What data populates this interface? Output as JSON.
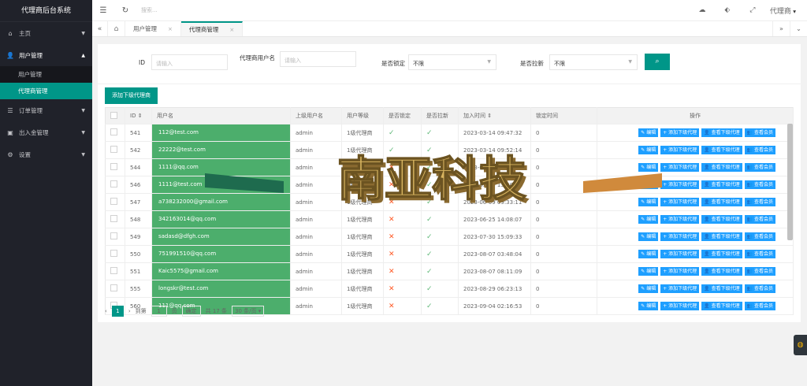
{
  "app_title": "代理商后台系统",
  "sidebar": {
    "items": [
      {
        "label": "主页"
      },
      {
        "label": "用户管理",
        "children": [
          "用户管理",
          "代理商管理"
        ]
      },
      {
        "label": "订单管理"
      },
      {
        "label": "出入金管理"
      },
      {
        "label": "设置"
      }
    ]
  },
  "topbar": {
    "search_placeholder": "搜索...",
    "user": "代理商"
  },
  "tabs": [
    {
      "label": "用户管理"
    },
    {
      "label": "代理商管理"
    }
  ],
  "filter": {
    "id_label": "ID",
    "id_placeholder": "请输入",
    "agent_label": "代理商用户名",
    "agent_placeholder": "请输入",
    "locked_label": "是否锁定",
    "locked_value": "不限",
    "blacklist_label": "是否拉新",
    "blacklist_value": "不限"
  },
  "add_button": "添加下级代理商",
  "table": {
    "columns": [
      "ID",
      "用户名",
      "上级用户名",
      "用户等级",
      "是否锁定",
      "是否拉新",
      "加入时间",
      "锁定时间",
      "操作"
    ],
    "rows": [
      {
        "id": "541",
        "user": "112@test.com",
        "parent": "admin",
        "level": "1级代理商",
        "locked": "yes",
        "new": "yes",
        "time": "2023-03-14 09:47:32",
        "lock": "0"
      },
      {
        "id": "542",
        "user": "22222@test.com",
        "parent": "admin",
        "level": "1级代理商",
        "locked": "yes",
        "new": "yes",
        "time": "2023-03-14 09:52:14",
        "lock": "0"
      },
      {
        "id": "544",
        "user": "1111@qq.com",
        "parent": "admin",
        "level": "1级代理商",
        "locked": "no",
        "new": "yes",
        "time": "2023-05-13 09:59:03",
        "lock": "0"
      },
      {
        "id": "546",
        "user": "1111@test.com",
        "parent": "admin",
        "level": "1级代理商",
        "locked": "no",
        "new": "yes",
        "time": "2023-05-15 13:20:14",
        "lock": "0"
      },
      {
        "id": "547",
        "user": "a738232000@gmail.com",
        "parent": "admin",
        "level": "1级代理商",
        "locked": "no",
        "new": "yes",
        "time": "2023-06-09 09:33:11",
        "lock": "0"
      },
      {
        "id": "548",
        "user": "342163014@qq.com",
        "parent": "admin",
        "level": "1级代理商",
        "locked": "no",
        "new": "yes",
        "time": "2023-06-25 14:08:07",
        "lock": "0"
      },
      {
        "id": "549",
        "user": "sadasd@dfgh.com",
        "parent": "admin",
        "level": "1级代理商",
        "locked": "no",
        "new": "yes",
        "time": "2023-07-30 15:09:33",
        "lock": "0"
      },
      {
        "id": "550",
        "user": "751991510@qq.com",
        "parent": "admin",
        "level": "1级代理商",
        "locked": "no",
        "new": "yes",
        "time": "2023-08-07 03:48:04",
        "lock": "0"
      },
      {
        "id": "551",
        "user": "Kaic5575@gmail.com",
        "parent": "admin",
        "level": "1级代理商",
        "locked": "no",
        "new": "yes",
        "time": "2023-08-07 08:11:09",
        "lock": "0"
      },
      {
        "id": "555",
        "user": "longskr@test.com",
        "parent": "admin",
        "level": "1级代理商",
        "locked": "no",
        "new": "yes",
        "time": "2023-08-29 06:23:13",
        "lock": "0"
      },
      {
        "id": "560",
        "user": "111@qq.com",
        "parent": "admin",
        "level": "1级代理商",
        "locked": "no",
        "new": "yes",
        "time": "2023-09-04 02:16:53",
        "lock": "0"
      }
    ],
    "actions": [
      "编辑",
      "添加下级代理",
      "查看下级代理",
      "查看会员"
    ]
  },
  "pager": {
    "current": "1",
    "goto": "到第",
    "page_input": "1",
    "page_unit": "页",
    "confirm": "确定",
    "total": "共 17 条",
    "per_page": "30 条/页"
  },
  "watermark": "南亚科技",
  "colors": {
    "accent": "#009688",
    "sidebar": "#20222a",
    "action": "#1e9fff",
    "username_bg": "#4cae6c"
  }
}
